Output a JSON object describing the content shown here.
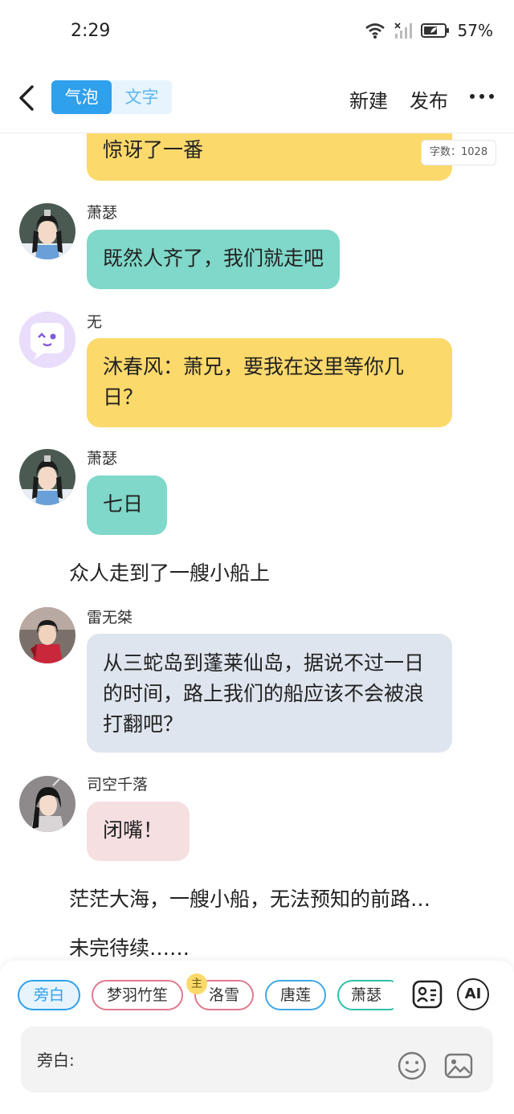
{
  "status_bar": {
    "time": "2:29",
    "battery_percent": "57%",
    "icons": [
      "wifi-icon",
      "no-signal-icon",
      "battery-icon"
    ]
  },
  "nav": {
    "modes": [
      {
        "label": "气泡",
        "active": true
      },
      {
        "label": "文字",
        "active": false
      }
    ],
    "new_label": "新建",
    "publish_label": "发布",
    "more_icon": "more-icon",
    "back_icon": "back-arrow-icon"
  },
  "word_count": "字数：1028",
  "messages": [
    {
      "type": "bubble",
      "speaker": "",
      "text": "惊讶了一番",
      "color": "#fcd96b"
    },
    {
      "type": "bubble",
      "speaker": "萧瑟",
      "text": "既然人齐了，我们就走吧",
      "color": "#7fd8c9"
    },
    {
      "type": "bubble",
      "speaker": "无",
      "text": "沐春风：萧兄，要我在这里等你几日？",
      "color": "#fcd96b"
    },
    {
      "type": "bubble",
      "speaker": "萧瑟",
      "text": "七日",
      "color": "#7fd8c9"
    },
    {
      "type": "narration",
      "text": "众人走到了一艘小船上"
    },
    {
      "type": "bubble",
      "speaker": "雷无桀",
      "text": "从三蛇岛到蓬莱仙岛，据说不过一日的时间，路上我们的船应该不会被浪打翻吧？",
      "color": "#dfe5ee"
    },
    {
      "type": "bubble",
      "speaker": "司空千落",
      "text": "闭嘴！",
      "color": "#f6dfe1"
    },
    {
      "type": "narration",
      "text": "茫茫大海，一艘小船，无法预知的前路…"
    },
    {
      "type": "narration",
      "text": "未完待续……"
    }
  ],
  "roles": [
    {
      "label": "旁白",
      "active": true
    },
    {
      "label": "梦羽竹笙",
      "active": false
    },
    {
      "label": "洛雪",
      "active": false,
      "badge": "主"
    },
    {
      "label": "唐莲",
      "active": false
    },
    {
      "label": "萧瑟",
      "active": false
    }
  ],
  "tools": {
    "contact_card_icon": "contact-card-icon",
    "ai_label": "AI"
  },
  "input": {
    "label": "旁白:",
    "emoji_icon": "emoji-icon",
    "image_icon": "image-icon"
  },
  "colors": {
    "accent": "#2ea0ec",
    "yellow_bubble": "#fcd96b",
    "teal_bubble": "#7fd8c9",
    "grey_bubble": "#dfe5ee",
    "pink_bubble": "#f6dfe1"
  }
}
